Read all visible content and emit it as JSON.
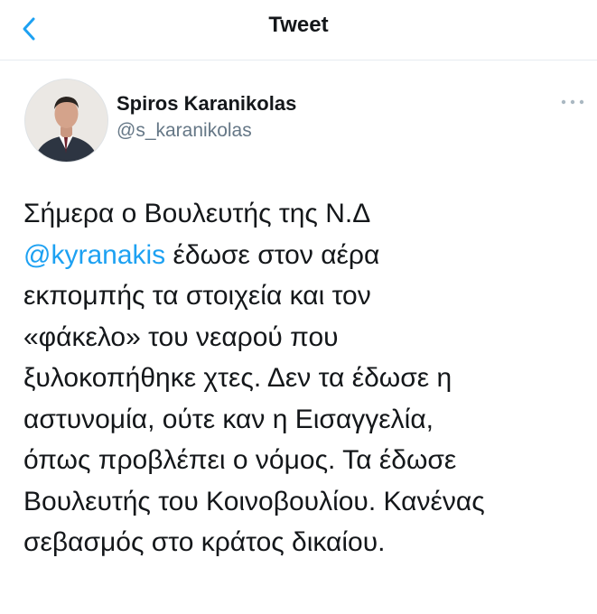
{
  "header": {
    "title": "Tweet",
    "back_icon": "chevron-left-icon",
    "accent_color": "#1da1f2"
  },
  "author": {
    "display_name": "Spiros Karanikolas",
    "handle": "@s_karanikolas",
    "avatar_icon": "avatar"
  },
  "menu": {
    "icon": "more-horizontal-icon"
  },
  "tweet": {
    "lines": [
      {
        "text": "Σήμερα ο Βουλευτής της Ν.Δ"
      },
      {
        "mention": "@kyranakis",
        "text": " έδωσε στον αέρα"
      },
      {
        "text": "εκπομπής τα στοιχεία και τον"
      },
      {
        "text": "«φάκελο» του νεαρού που"
      },
      {
        "text": "ξυλοκοπήθηκε χτες. Δεν τα έδωσε η"
      },
      {
        "text": "αστυνομία, ούτε καν η Εισαγγελία,"
      },
      {
        "text": "όπως προβλέπει ο νόμος. Τα έδωσε"
      },
      {
        "text": "Βουλευτής του Κοινοβουλίου. Κανένας"
      },
      {
        "text": "σεβασμός στο κράτος δικαίου."
      }
    ]
  }
}
